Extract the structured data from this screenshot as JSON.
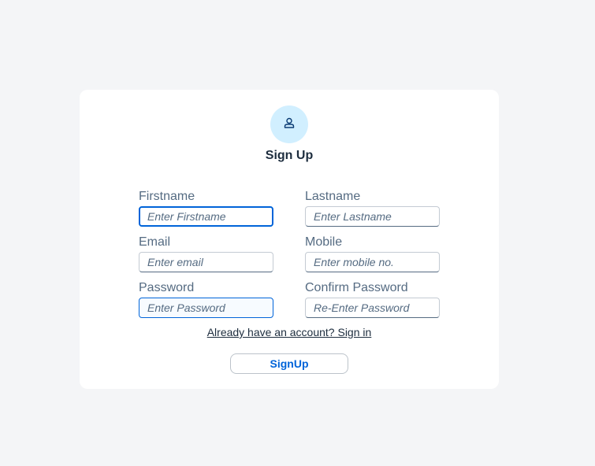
{
  "form": {
    "title": "Sign Up",
    "avatar_icon": "user-icon",
    "accent_color": "#0064d9",
    "fields": {
      "firstname": {
        "label": "Firstname",
        "placeholder": "Enter Firstname",
        "value": ""
      },
      "lastname": {
        "label": "Lastname",
        "placeholder": "Enter Lastname",
        "value": ""
      },
      "email": {
        "label": "Email",
        "placeholder": "Enter email",
        "value": ""
      },
      "mobile": {
        "label": "Mobile",
        "placeholder": "Enter mobile no.",
        "value": ""
      },
      "password": {
        "label": "Password",
        "placeholder": "Enter Password",
        "value": ""
      },
      "confirm_password": {
        "label": "Confirm Password",
        "placeholder": "Re-Enter Password",
        "value": ""
      }
    },
    "signin_link": "Already have an account? Sign in",
    "submit_label": "SignUp"
  }
}
